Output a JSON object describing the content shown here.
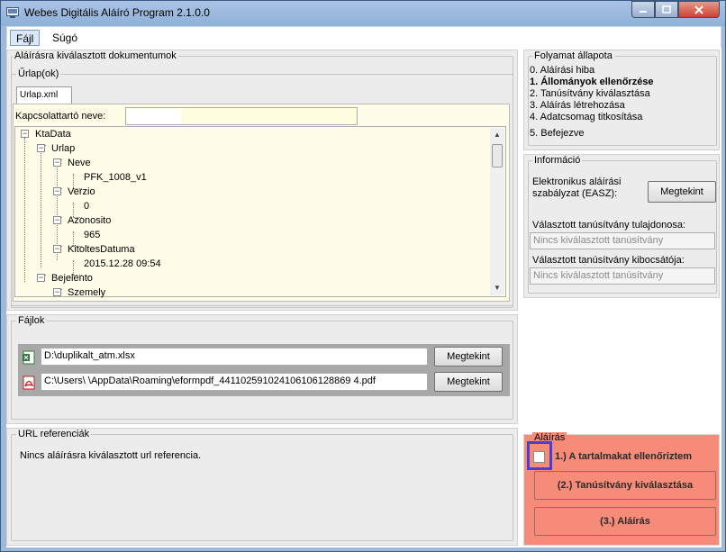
{
  "window": {
    "title": "Webes Digitális Aláíró Program 2.1.0.0",
    "controls": {
      "minimize": "▁",
      "maximize": "□",
      "close": "✕"
    }
  },
  "menu": {
    "file": "Fájl",
    "help": "Súgó"
  },
  "documents": {
    "group_title": "Aláírásra kiválasztott dokumentumok",
    "forms_title": "Űrlap(ok)",
    "tab": "Urlap.xml",
    "contact_label": "Kapcsolattartó neve:",
    "contact_value": "",
    "tree": {
      "root": "KtaData",
      "urlap": "Urlap",
      "neve": "Neve",
      "neve_value": "PFK_1008_v1",
      "verzio": "Verzio",
      "verzio_value": "0",
      "azonosito": "Azonosito",
      "azonosito_value": "965",
      "kitoltes": "KitoltesDatuma",
      "kitoltes_value": "2015.12.28 09:54",
      "bejelento": "Bejelento",
      "szemely": "Szemely"
    }
  },
  "files": {
    "group_title": "Fájlok",
    "items": [
      {
        "path": "D:\\duplikalt_atm.xlsx",
        "button": "Megtekint",
        "icon": "excel-icon"
      },
      {
        "path": "C:\\Users\\            \\AppData\\Roaming\\eformpdf_441102591024106106128869 4.pdf",
        "button": "Megtekint",
        "icon": "pdf-icon"
      }
    ]
  },
  "url_refs": {
    "group_title": "URL referenciák",
    "text": "Nincs aláírásra kiválasztott url referencia."
  },
  "progress": {
    "group_title": "Folyamat állapota",
    "steps": [
      "0. Aláírási hiba",
      "1. Állományok ellenőrzése",
      "2. Tanúsítvány kiválasztása",
      "3. Aláírás létrehozása",
      "4. Adatcsomag titkosítása",
      "5. Befejezve"
    ],
    "current_step": 1
  },
  "info": {
    "group_title": "Információ",
    "easz_label_1": "Elektronikus aláírási",
    "easz_label_2": "szabályzat (EASZ):",
    "easz_button": "Megtekint",
    "owner_label": "Választott tanúsítvány tulajdonosa:",
    "owner_value": "Nincs kiválasztott tanúsítvány",
    "issuer_label": "Választott tanúsítvány kibocsátója:",
    "issuer_value": "Nincs kiválasztott tanúsítvány"
  },
  "signing": {
    "group_title": "Aláírás",
    "check_label": "1.) A tartalmakat ellenőriztem",
    "check_checked": false,
    "cert_button": "(2.) Tanúsítvány kiválasztása",
    "sign_button": "(3.) Aláírás"
  },
  "colors": {
    "signing_panel": "#f58b78",
    "highlight_box": "#4a3fd1",
    "frame": "#9eb9d9"
  }
}
